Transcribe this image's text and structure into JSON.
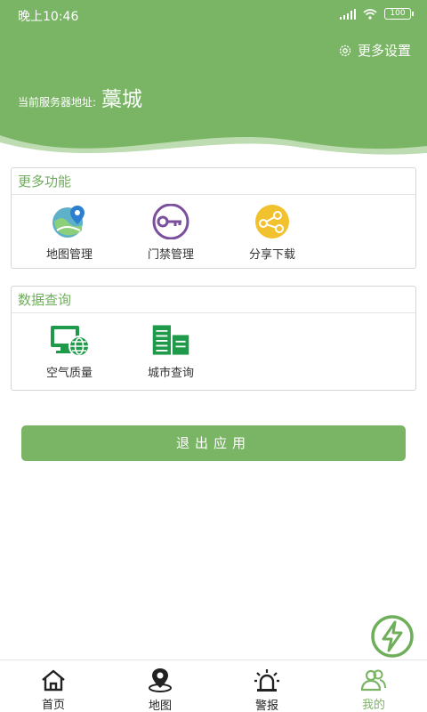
{
  "status_bar": {
    "time": "晚上10:46",
    "battery": "100"
  },
  "header": {
    "settings_label": "更多设置",
    "server_label": "当前服务器地址:",
    "server_value": "藁城"
  },
  "sections": [
    {
      "title": "更多功能",
      "items": [
        {
          "label": "地图管理",
          "icon": "map-pin-icon"
        },
        {
          "label": "门禁管理",
          "icon": "key-icon"
        },
        {
          "label": "分享下载",
          "icon": "share-icon"
        }
      ]
    },
    {
      "title": "数据查询",
      "items": [
        {
          "label": "空气质量",
          "icon": "monitor-globe-icon"
        },
        {
          "label": "城市查询",
          "icon": "buildings-icon"
        }
      ]
    }
  ],
  "logout_label": "退出应用",
  "float_button": {
    "icon": "lightning-icon"
  },
  "tabbar": {
    "active": "我的",
    "tabs": [
      {
        "label": "首页",
        "icon": "home-icon"
      },
      {
        "label": "地图",
        "icon": "location-icon"
      },
      {
        "label": "警报",
        "icon": "alarm-icon"
      },
      {
        "label": "我的",
        "icon": "users-icon"
      }
    ]
  },
  "colors": {
    "primary": "#7ab565",
    "accent_text": "#6fae5a",
    "key_purple": "#7b4f9c",
    "share_yellow": "#f2c12e",
    "data_green": "#1f9a4a"
  }
}
